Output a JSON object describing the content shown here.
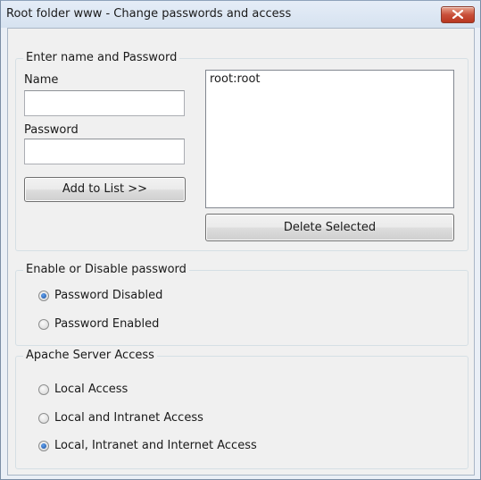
{
  "window": {
    "title": "Root folder www - Change passwords and access"
  },
  "credentials_group": {
    "legend": "Enter name and Password",
    "name_label": "Name",
    "name_value": "",
    "password_label": "Password",
    "password_value": "",
    "add_button": "Add to List >>",
    "list_items": [
      "root:root"
    ],
    "delete_button": "Delete Selected"
  },
  "password_group": {
    "legend": "Enable or Disable password",
    "options": [
      {
        "label": "Password Disabled",
        "selected": true
      },
      {
        "label": "Password Enabled",
        "selected": false
      }
    ]
  },
  "access_group": {
    "legend": "Apache Server Access",
    "options": [
      {
        "label": "Local Access",
        "selected": false
      },
      {
        "label": "Local and Intranet Access",
        "selected": false
      },
      {
        "label": "Local, Intranet and Internet Access",
        "selected": true
      }
    ]
  },
  "colors": {
    "close_button": "#c9503a",
    "radio_selected": "#1b4f9c"
  }
}
